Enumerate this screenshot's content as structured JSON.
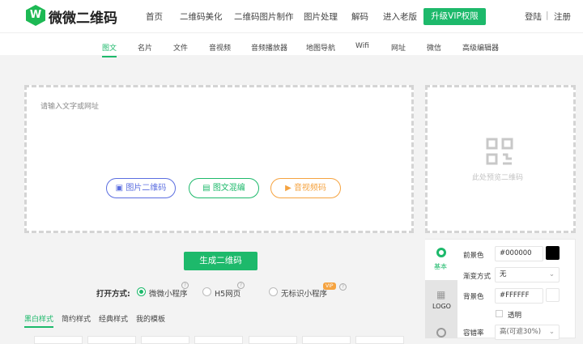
{
  "header": {
    "logo_mark": "W",
    "logo_text": "微微二维码",
    "nav": [
      "首页",
      "二维码美化",
      "二维码图片制作",
      "图片处理",
      "解码",
      "进入老版"
    ],
    "vip_button": "升级VIP权限",
    "login": "登陆",
    "separator": "|",
    "register": "注册"
  },
  "subnav": [
    "图文",
    "名片",
    "文件",
    "音视频",
    "音频播放器",
    "地图导航",
    "Wifi",
    "网址",
    "微信",
    "高级编辑器"
  ],
  "editor": {
    "placeholder": "请输入文字或网址",
    "buttons": [
      "图片二维码",
      "图文混编",
      "音视频码"
    ]
  },
  "preview": {
    "placeholder": "此处预览二维码"
  },
  "generate_button": "生成二维码",
  "open_mode": {
    "label": "打开方式:",
    "options": [
      "微微小程序",
      "H5网页",
      "无标识小程序"
    ],
    "selected": "微微小程序",
    "vip_badge": "VIP",
    "help": "?"
  },
  "style_tabs": [
    "黑白样式",
    "简约样式",
    "经典样式",
    "我的模板"
  ],
  "settings": {
    "tabs": [
      "基本",
      "LOGO"
    ],
    "fg_label": "前景色",
    "fg_value": "#000000",
    "gradient_label": "渐变方式",
    "gradient_value": "无",
    "bg_label": "背景色",
    "bg_value": "#FFFFFF",
    "transparent_label": "透明",
    "ecc_label": "容错率",
    "ecc_value": "高(可遮30%)"
  },
  "colors": {
    "accent": "#1db96b",
    "blue": "#5b6ee0",
    "orange": "#f5a340"
  }
}
